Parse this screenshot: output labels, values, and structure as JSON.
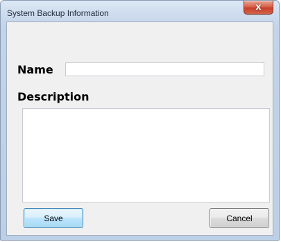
{
  "window": {
    "title": "System Backup Information",
    "close_glyph": "x",
    "close_icon": "close-icon"
  },
  "form": {
    "name_label": "Name",
    "name_value": "",
    "description_label": "Description",
    "description_value": ""
  },
  "buttons": {
    "save_label": "Save",
    "cancel_label": "Cancel"
  },
  "colors": {
    "close_button": "#c8402a",
    "save_button_border": "#3c7fb1",
    "client_background": "#f0f0f0"
  }
}
